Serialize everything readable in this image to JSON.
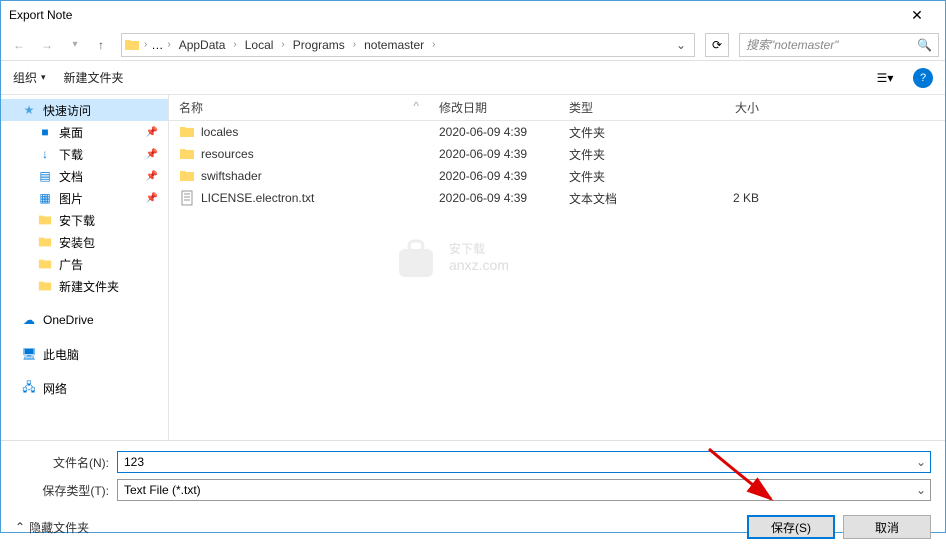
{
  "window": {
    "title": "Export Note"
  },
  "breadcrumb": {
    "segments": [
      "AppData",
      "Local",
      "Programs",
      "notemaster"
    ]
  },
  "search": {
    "placeholder": "搜索\"notemaster\""
  },
  "toolbar": {
    "organize": "组织",
    "newfolder": "新建文件夹"
  },
  "columns": {
    "name": "名称",
    "date": "修改日期",
    "type": "类型",
    "size": "大小"
  },
  "sidebar": {
    "quick": "快速访问",
    "items": [
      {
        "label": "桌面",
        "pin": true
      },
      {
        "label": "下载",
        "pin": true
      },
      {
        "label": "文档",
        "pin": true
      },
      {
        "label": "图片",
        "pin": true
      },
      {
        "label": "安下载",
        "pin": false
      },
      {
        "label": "安装包",
        "pin": false
      },
      {
        "label": "广告",
        "pin": false
      },
      {
        "label": "新建文件夹",
        "pin": false
      }
    ],
    "onedrive": "OneDrive",
    "thispc": "此电脑",
    "network": "网络"
  },
  "files": [
    {
      "name": "locales",
      "date": "2020-06-09 4:39",
      "type": "文件夹",
      "size": "",
      "kind": "folder"
    },
    {
      "name": "resources",
      "date": "2020-06-09 4:39",
      "type": "文件夹",
      "size": "",
      "kind": "folder"
    },
    {
      "name": "swiftshader",
      "date": "2020-06-09 4:39",
      "type": "文件夹",
      "size": "",
      "kind": "folder"
    },
    {
      "name": "LICENSE.electron.txt",
      "date": "2020-06-09 4:39",
      "type": "文本文档",
      "size": "2 KB",
      "kind": "txt"
    }
  ],
  "form": {
    "filename_label": "文件名(N):",
    "filename_value": "123",
    "filetype_label": "保存类型(T):",
    "filetype_value": "Text File (*.txt)"
  },
  "buttons": {
    "hide": "隐藏文件夹",
    "save": "保存(S)",
    "cancel": "取消"
  },
  "watermark": {
    "main": "安下载",
    "sub": "anxz.com"
  }
}
